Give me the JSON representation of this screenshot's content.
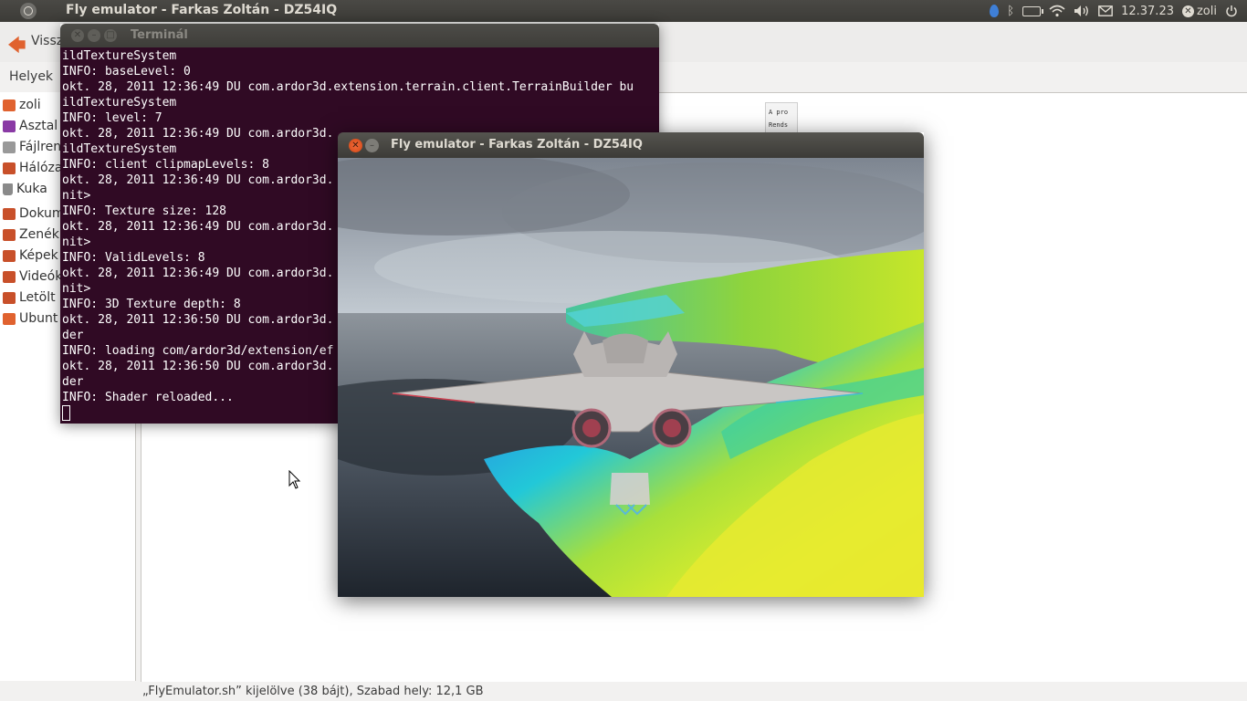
{
  "top_panel": {
    "app_title": "Fly emulator - Farkas Zoltán - DZ54IQ",
    "clock": "12.37.23",
    "user": "zoli"
  },
  "file_manager": {
    "back_label": "Vissz",
    "places_header": "Helyek",
    "sidebar_items": [
      {
        "label": "zoli",
        "icon": "home-folder-icon",
        "color": "#e0622f"
      },
      {
        "label": "Asztal",
        "icon": "desktop-icon",
        "color": "#8a3aa5"
      },
      {
        "label": "Fájlren",
        "icon": "drive-icon",
        "color": "#888888"
      },
      {
        "label": "Hálóza",
        "icon": "network-folder-icon",
        "color": "#c8502a"
      },
      {
        "label": "Kuka",
        "icon": "trash-icon",
        "color": "#777777"
      },
      {
        "label": "Dokum",
        "icon": "documents-folder-icon",
        "color": "#c8502a"
      },
      {
        "label": "Zenék",
        "icon": "music-folder-icon",
        "color": "#c8502a"
      },
      {
        "label": "Képek",
        "icon": "pictures-folder-icon",
        "color": "#c8502a"
      },
      {
        "label": "Videók",
        "icon": "videos-folder-icon",
        "color": "#c8502a"
      },
      {
        "label": "Letölt",
        "icon": "downloads-folder-icon",
        "color": "#c8502a"
      },
      {
        "label": "Ubunt",
        "icon": "ubuntu-one-folder-icon",
        "color": "#e0622f"
      }
    ],
    "file_icon_text": [
      "A pro",
      "Rends"
    ],
    "status_text": "„FlyEmulator.sh” kijelölve (38 bájt), Szabad hely: 12,1 GB"
  },
  "terminal": {
    "title": "Terminál",
    "lines": [
      "ildTextureSystem",
      "INFO: baseLevel: 0",
      "okt. 28, 2011 12:36:49 DU com.ardor3d.extension.terrain.client.TerrainBuilder bu",
      "ildTextureSystem",
      "INFO: level: 7",
      "okt. 28, 2011 12:36:49 DU com.ardor3d.",
      "ildTextureSystem",
      "INFO: client clipmapLevels: 8",
      "okt. 28, 2011 12:36:49 DU com.ardor3d.",
      "nit>",
      "INFO: Texture size: 128",
      "okt. 28, 2011 12:36:49 DU com.ardor3d.",
      "nit>",
      "INFO: ValidLevels: 8",
      "okt. 28, 2011 12:36:49 DU com.ardor3d.",
      "nit>",
      "INFO: 3D Texture depth: 8",
      "okt. 28, 2011 12:36:50 DU com.ardor3d.",
      "der",
      "INFO: loading com/ardor3d/extension/ef",
      "okt. 28, 2011 12:36:50 DU com.ardor3d.",
      "der",
      "INFO: Shader reloaded..."
    ]
  },
  "fly_window": {
    "title": "Fly emulator - Farkas Zoltán - DZ54IQ"
  },
  "colors": {
    "terminal_bg": "#300a24",
    "panel_bg": "#3c3b37",
    "close_button": "#e0622f"
  }
}
